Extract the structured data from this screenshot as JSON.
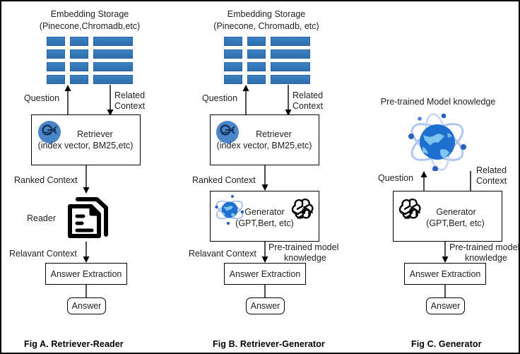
{
  "theme": {
    "bar_blue": "#3478bd",
    "circle_blue": "#4a86c8",
    "globe_blue": "#1f6fd0",
    "text": "#222222",
    "border": "#000000"
  },
  "figures": [
    {
      "caption": "Fig A. Retriever-Reader",
      "storage_title_line1": "Embedding Storage",
      "storage_title_line2": "(Pinecone,Chromadb,etc)",
      "edge_question": "Question",
      "edge_related_line1": "Related",
      "edge_related_line2": "Context",
      "retriever_line1": "Retriever",
      "retriever_line2": "(index vector, BM25,etc)",
      "edge_ranked": "Ranked Context",
      "reader_label": "Reader",
      "edge_relevant": "Relavant Context",
      "answer_extraction": "Answer Extraction",
      "answer": "Answer"
    },
    {
      "caption": "Fig B. Retriever-Generator",
      "storage_title_line1": "Embedding Storage",
      "storage_title_line2": "(Pinecone, Chromadb, etc)",
      "edge_question": "Question",
      "edge_related_line1": "Related",
      "edge_related_line2": "Context",
      "retriever_line1": "Retriever",
      "retriever_line2": "(index vector, BM25,etc)",
      "edge_ranked": "Ranked Context",
      "generator_line1": "Generator",
      "generator_line2": "(GPT,Bert, etc)",
      "edge_relevant": "Relavant Context",
      "edge_pretrained_line1": "Pre-trained model",
      "edge_pretrained_line2": "knowledge",
      "answer_extraction": "Answer Extraction",
      "answer": "Answer"
    },
    {
      "caption": "Fig C. Generator",
      "knowledge_title": "Pre-trained Model knowledge",
      "edge_question": "Question",
      "edge_related_line1": "Related",
      "edge_related_line2": "Context",
      "generator_line1": "Generator",
      "generator_line2": "(GPT,Bert, etc)",
      "edge_pretrained_line1": "Pre-trained model",
      "edge_pretrained_line2": "knowledge",
      "answer_extraction": "Answer Extraction",
      "answer": "Answer"
    }
  ]
}
